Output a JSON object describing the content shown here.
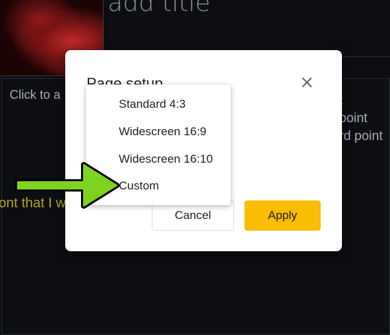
{
  "slide": {
    "title_placeholder": "Click to add title",
    "body_placeholder": "Click to a",
    "right_lines": [
      "t",
      "point",
      "rd point"
    ],
    "yellow_text": "ont that I w"
  },
  "dialog": {
    "title": "Page setup",
    "cancel_label": "Cancel",
    "apply_label": "Apply"
  },
  "menu": {
    "items": [
      {
        "label": "Standard 4:3"
      },
      {
        "label": "Widescreen 16:9"
      },
      {
        "label": "Widescreen 16:10"
      },
      {
        "label": "Custom"
      }
    ]
  },
  "annotation": {
    "arrow_color": "#7ed321",
    "arrow_points_to": "Custom"
  },
  "colors": {
    "apply_button": "#fbbc04",
    "yellow_text": "#b5a81c"
  }
}
